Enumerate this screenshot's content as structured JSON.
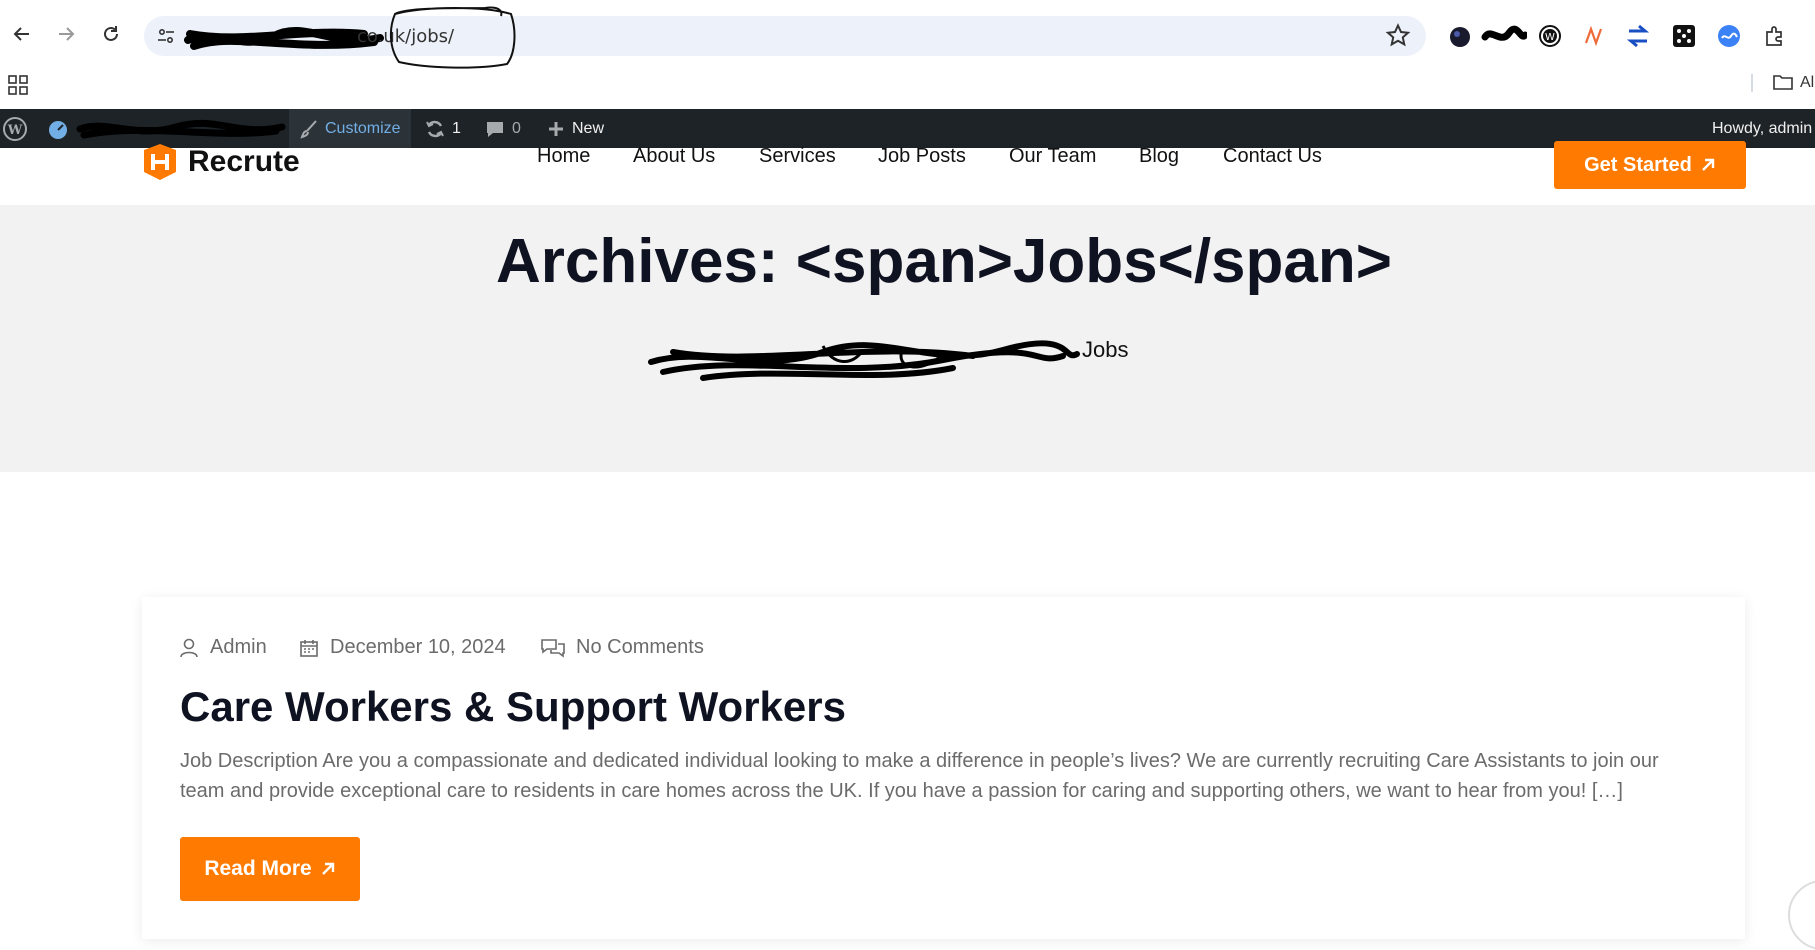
{
  "browser": {
    "url_visible": "co.uk/jobs/",
    "bookmarks_label": "Al"
  },
  "adminbar": {
    "customize": "Customize",
    "updates_count": "1",
    "comments_count": "0",
    "new_label": "New",
    "howdy": "Howdy, admin"
  },
  "site": {
    "logo_text": "Recrute",
    "menu": [
      "Home",
      "About Us",
      "Services",
      "Job Posts",
      "Our Team",
      "Blog",
      "Contact Us"
    ],
    "cta": "Get Started"
  },
  "hero": {
    "title": "Archives: <span>Jobs</span>",
    "breadcrumb_current": "Jobs"
  },
  "post": {
    "author": "Admin",
    "date": "December 10, 2024",
    "comments": "No Comments",
    "title": "Care Workers & Support Workers",
    "excerpt": "Job Description Are you a compassionate and dedicated individual looking to make a difference in people’s lives? We are currently recruiting Care Assistants to join our team and provide exceptional care to residents in care homes across the UK. If you have a passion for caring and supporting others, we want to hear from you! […]",
    "read_more": "Read More"
  },
  "colors": {
    "accent": "#ff7a00",
    "adminbar": "#1d2327",
    "hero_bg": "#f3f2f3",
    "omnibox": "#edf2fa",
    "heading": "#0f1221",
    "meta_text": "#6b6b6b"
  }
}
